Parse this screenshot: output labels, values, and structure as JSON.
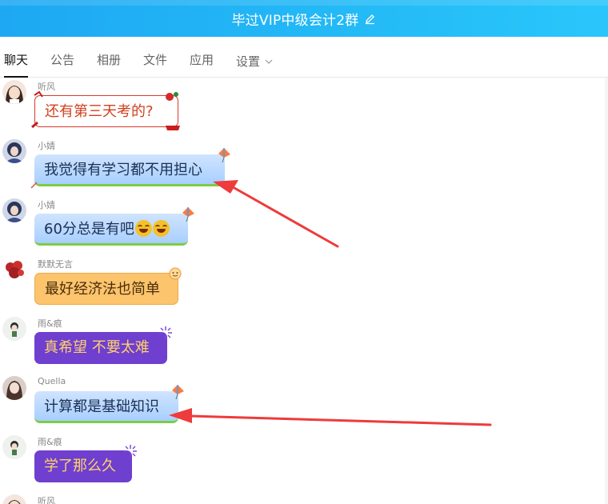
{
  "window": {
    "title": "毕过VIP中级会计2群",
    "title_icon": "edit-icon"
  },
  "tabs": [
    {
      "label": "聊天",
      "active": true
    },
    {
      "label": "公告",
      "active": false
    },
    {
      "label": "相册",
      "active": false
    },
    {
      "label": "文件",
      "active": false
    },
    {
      "label": "应用",
      "active": false
    },
    {
      "label": "设置",
      "active": false,
      "has_dropdown": true
    }
  ],
  "messages": [
    {
      "sender": "听风",
      "text": "还有第三天考的?",
      "bubble_style": "red-festive"
    },
    {
      "sender": "小婧",
      "text": "我觉得有学习都不用担心",
      "bubble_style": "blue-kite"
    },
    {
      "sender": "小婧",
      "text": "60分总是有吧",
      "bubble_style": "blue-kite",
      "emojis": [
        "grinning-tears-emoji",
        "grinning-tears-emoji"
      ]
    },
    {
      "sender": "默默无言",
      "text": "最好经济法也简单",
      "bubble_style": "orange-cute"
    },
    {
      "sender": "雨&痕",
      "text": "真希望 不要太难",
      "bubble_style": "purple-firework"
    },
    {
      "sender": "Quella",
      "text": "计算都是基础知识",
      "bubble_style": "blue-kite"
    },
    {
      "sender": "雨&痕",
      "text": "学了那么久",
      "bubble_style": "purple-firework"
    },
    {
      "sender": "听风",
      "text": "",
      "bubble_style": "red-festive"
    }
  ],
  "colors": {
    "titlebar": "#23b9f6",
    "annotation_arrow": "#ee3b3b",
    "bubble_blue": "#b7d8ff",
    "bubble_orange": "#fbc46d",
    "bubble_purple": "#6f3fcf",
    "bubble_red_border": "#d83a2b"
  }
}
